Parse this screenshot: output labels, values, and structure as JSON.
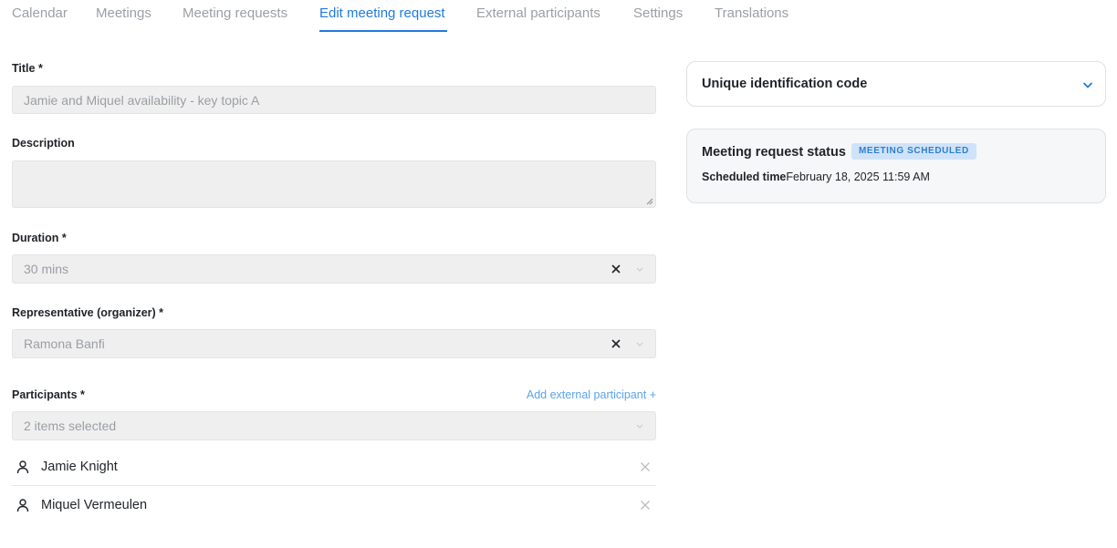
{
  "tabs": [
    {
      "label": "Calendar"
    },
    {
      "label": "Meetings"
    },
    {
      "label": "Meeting requests"
    },
    {
      "label": "Edit meeting request",
      "active": true
    },
    {
      "label": "External participants"
    },
    {
      "label": "Settings"
    },
    {
      "label": "Translations"
    }
  ],
  "form": {
    "title_label": "Title *",
    "title_value": "Jamie and Miquel availability - key topic A",
    "description_label": "Description",
    "description_value": "",
    "duration_label": "Duration *",
    "duration_value": "30 mins",
    "representative_label": "Representative (organizer) *",
    "representative_value": "Ramona Banfi",
    "participants_label": "Participants *",
    "add_external_label": "Add external participant +",
    "participants_select_value": "2 items selected",
    "participants": [
      {
        "name": "Jamie Knight"
      },
      {
        "name": "Miquel Vermeulen"
      }
    ]
  },
  "side": {
    "uid_title": "Unique identification code",
    "status_title": "Meeting request status",
    "status_badge": "MEETING SCHEDULED",
    "scheduled_label": "Scheduled time",
    "scheduled_value": "February 18, 2025 11:59 AM"
  },
  "colors": {
    "accent": "#1f7ae0",
    "badge_bg": "#cfe3f8",
    "badge_text": "#2f7fd0",
    "link": "#5ba3ea"
  },
  "icons": [
    "close-icon",
    "chevron-down-icon",
    "user-icon"
  ]
}
